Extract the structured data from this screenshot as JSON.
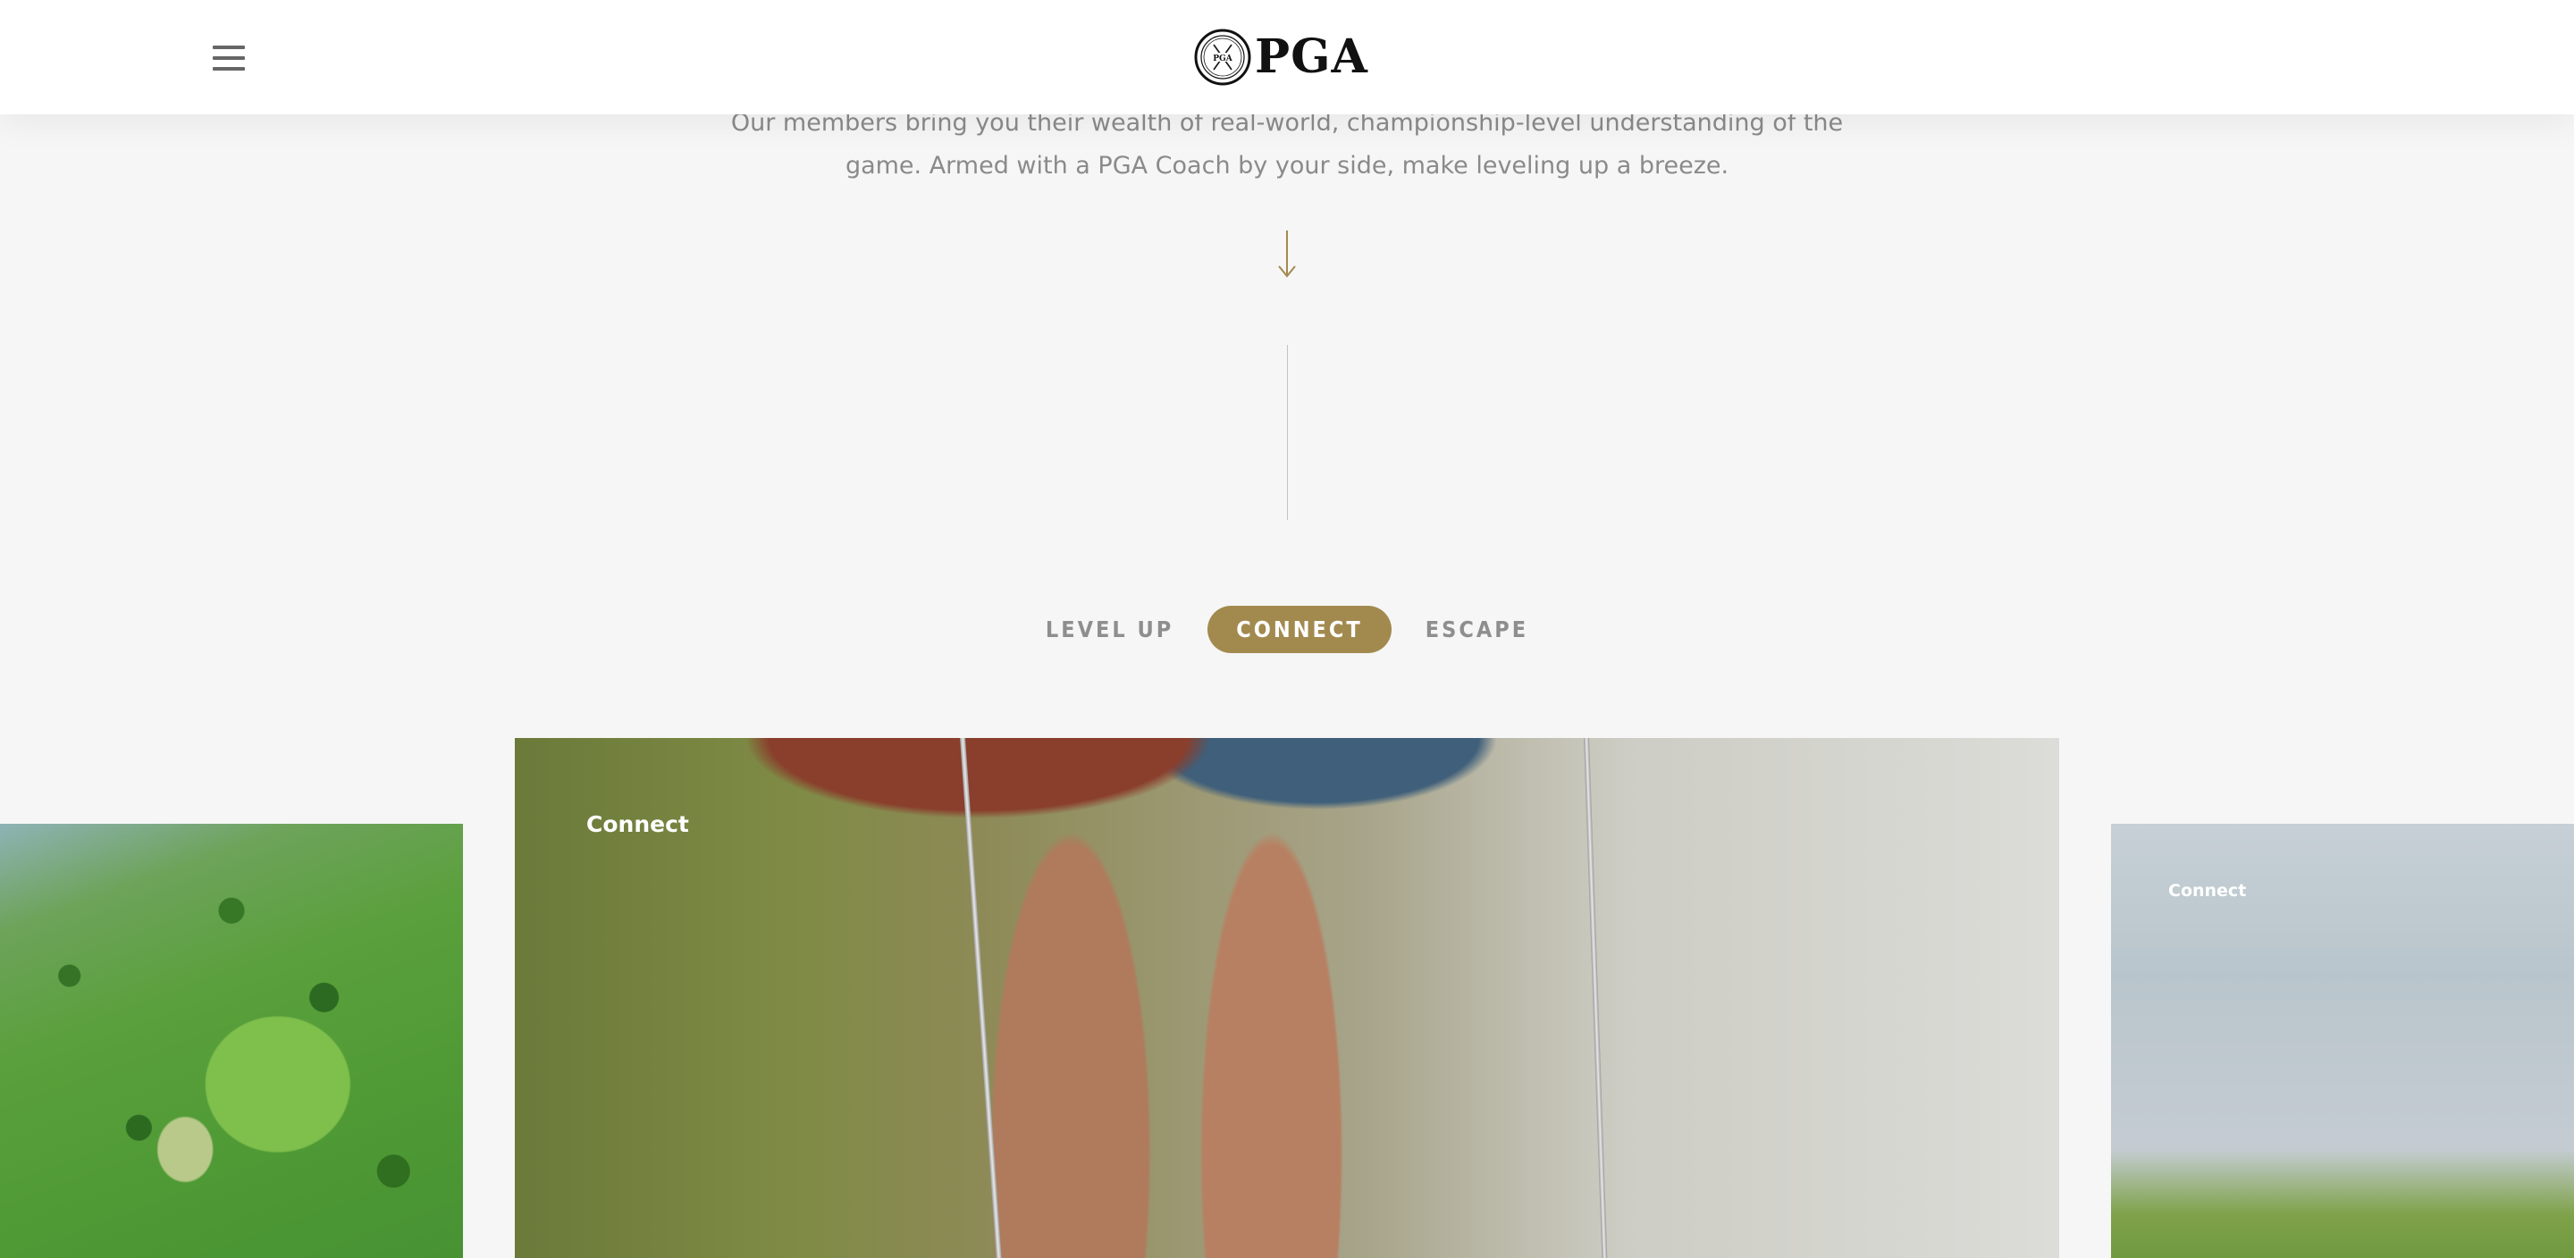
{
  "header": {
    "menu_icon": "hamburger-menu-icon",
    "logo_text": "PGA",
    "logo_seal_icon": "pga-seal-icon"
  },
  "intro": {
    "line1": "Our members bring you their wealth of real-world, championship-level understanding of the",
    "line2": "game. Armed with a PGA Coach by your side, make leveling up a breeze.",
    "arrow_icon": "arrow-down-icon"
  },
  "tabs": [
    {
      "label": "LEVEL UP",
      "active": false
    },
    {
      "label": "CONNECT",
      "active": true
    },
    {
      "label": "ESCAPE",
      "active": false
    }
  ],
  "carousel": {
    "cards": [
      {
        "position": "left",
        "label": "",
        "image": "aerial-golf-course-image"
      },
      {
        "position": "center",
        "label": "Connect",
        "image": "golfers-legs-with-clubs-image"
      },
      {
        "position": "right",
        "label": "Connect",
        "image": "golfer-by-water-image"
      }
    ]
  },
  "colors": {
    "accent": "#a28a4f",
    "background": "#f6f6f6",
    "header_bg": "#ffffff",
    "muted_text": "#8a8a8a"
  }
}
